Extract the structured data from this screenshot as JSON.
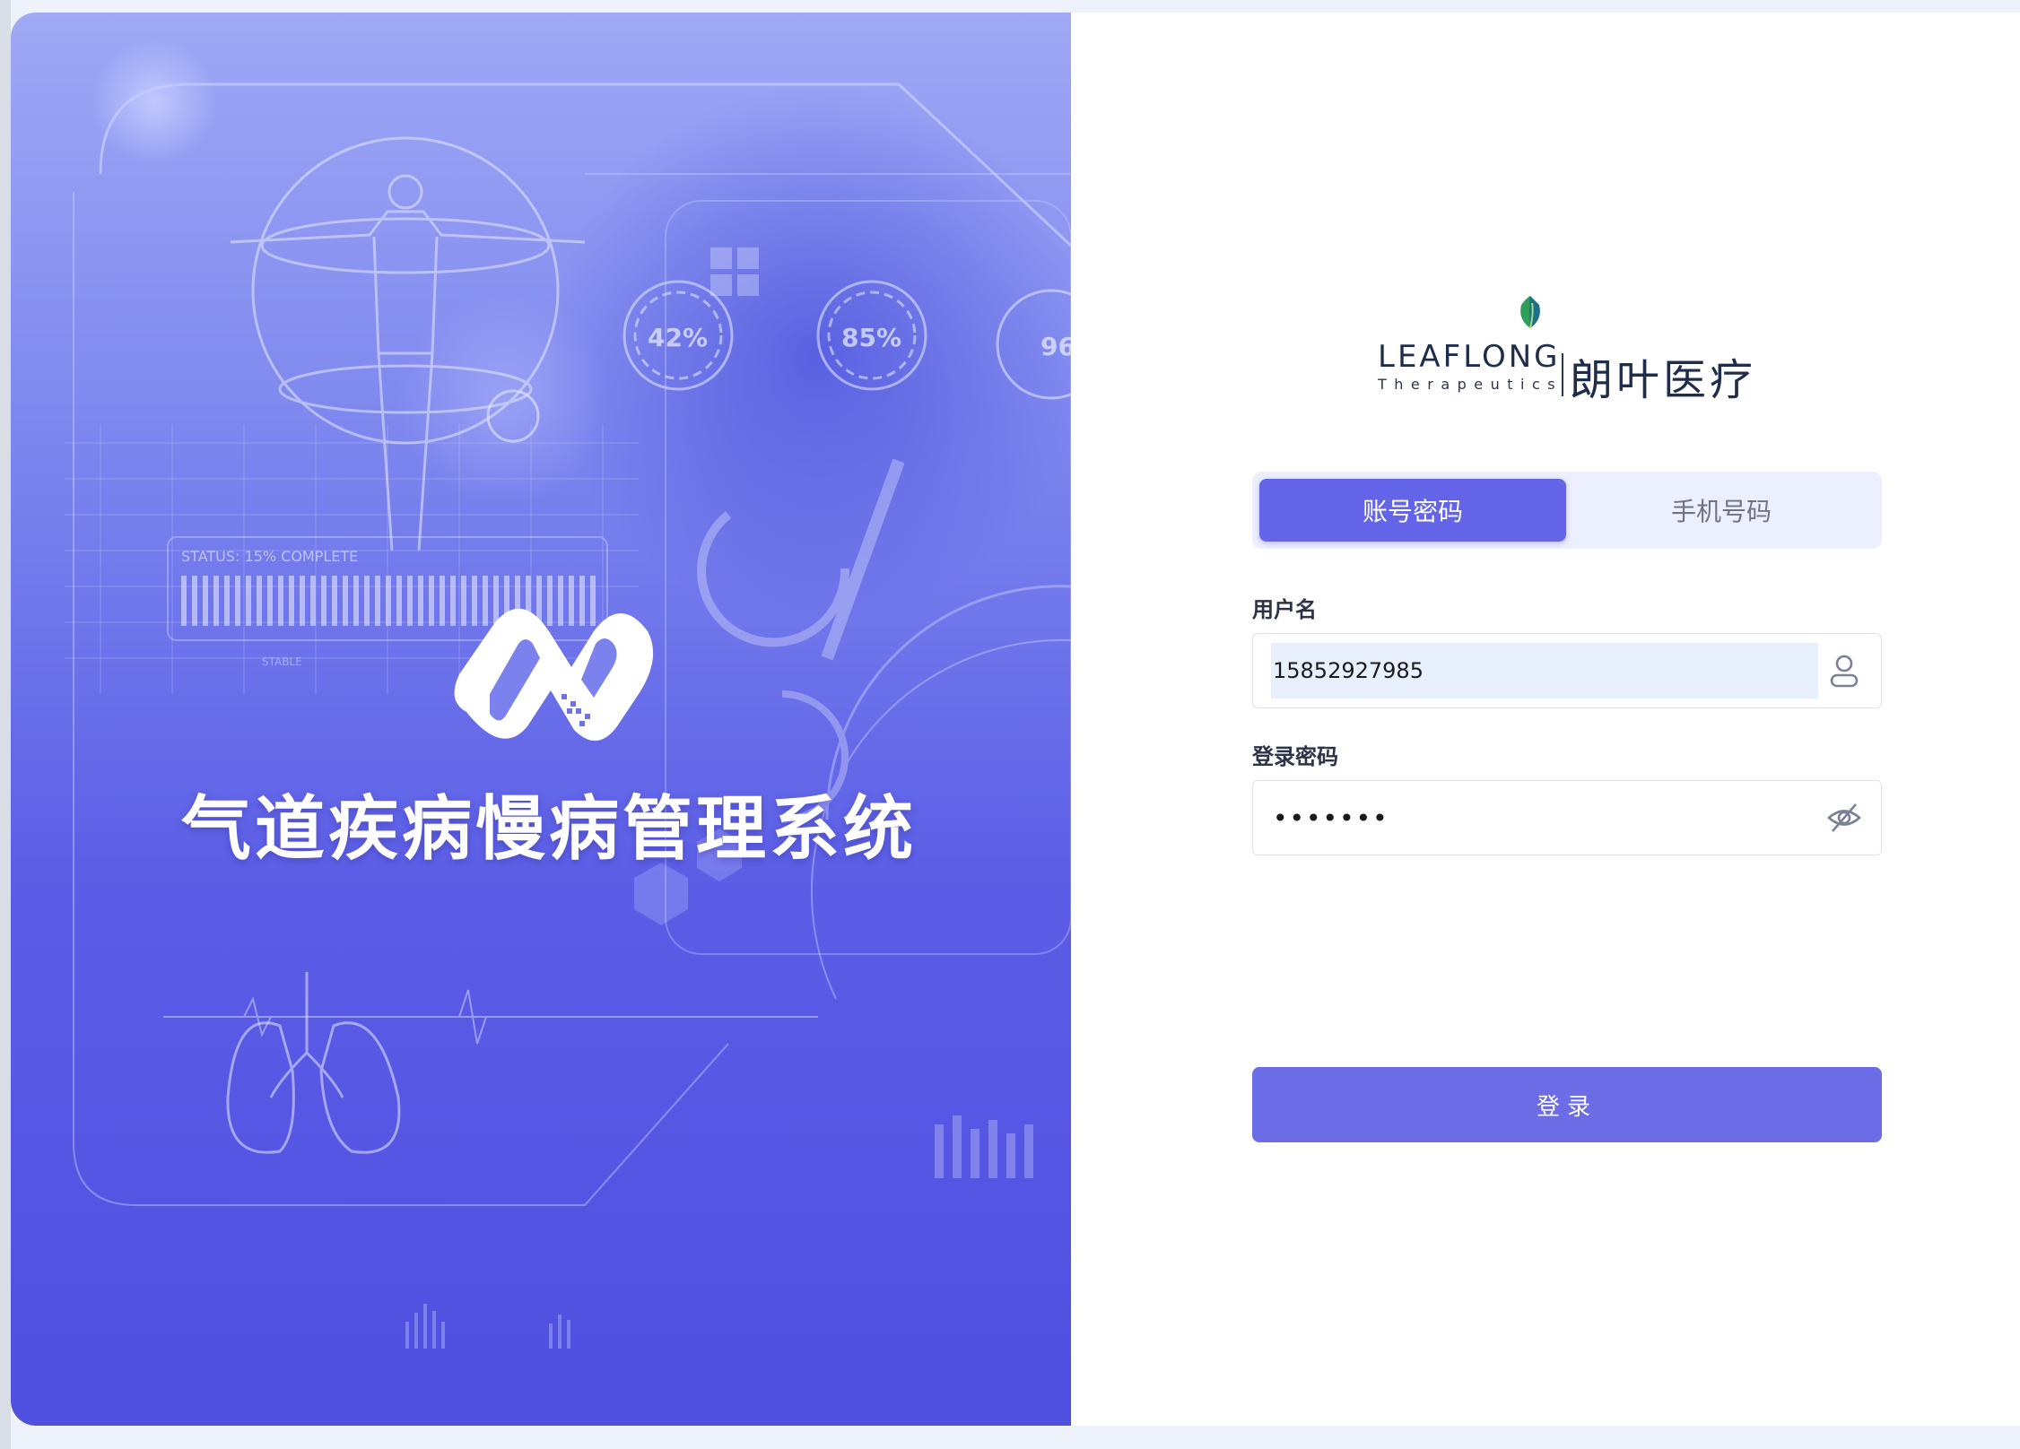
{
  "app": {
    "system_title": "气道疾病慢病管理系统"
  },
  "hud": {
    "gauge1": "42%",
    "gauge2": "85%",
    "gauge3": "96",
    "status_text": "STATUS: 15% COMPLETE",
    "stable_text": "STABLE"
  },
  "brand": {
    "name_en": "LEAFLONG",
    "sub_en": "Therapeutics",
    "name_cn": "朗叶医疗"
  },
  "tabs": [
    {
      "label": "账号密码",
      "active": true
    },
    {
      "label": "手机号码",
      "active": false
    }
  ],
  "form": {
    "username_label": "用户名",
    "username_value": "15852927985",
    "password_label": "登录密码",
    "password_value": "•••••••",
    "submit_label": "登录"
  },
  "colors": {
    "accent": "#6464e8",
    "panel_gradient_top": "#9fa9f5",
    "panel_gradient_bottom": "#4f4fe0"
  },
  "icons": {
    "username": "user-icon",
    "password": "eye-off-icon"
  }
}
